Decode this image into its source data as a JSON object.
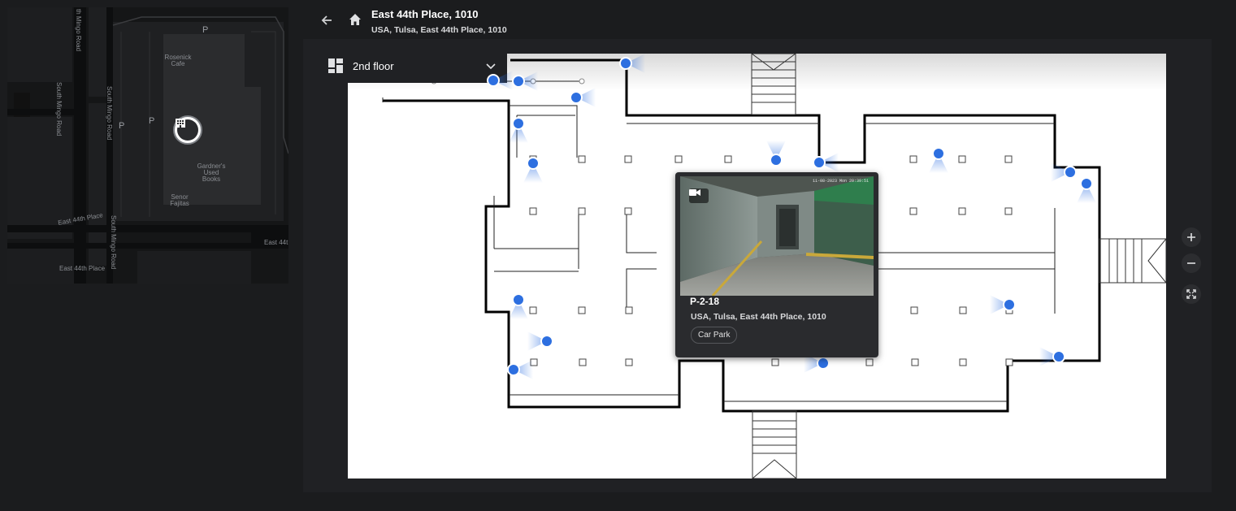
{
  "header": {
    "title": "East 44th Place, 1010",
    "subtitle": "USA, Tulsa, East 44th Place, 1010"
  },
  "minimap": {
    "labels": {
      "road_1": "th Mingo Road",
      "road_2": "South Mingo Road",
      "road_3": "South Mingo Road",
      "road_4": "East 44th Place",
      "road_5": "South Mingo Road",
      "road_6": "East 44th Place",
      "road_7": "East 44t",
      "poi_1": "Rosenick Cafe",
      "poi_2": "Gardner's Used Books",
      "poi_3": "Senor Fajitas",
      "parking": "P"
    }
  },
  "floor_selector": {
    "label": "2nd floor"
  },
  "popup": {
    "name": "P-2-18",
    "address": "USA, Tulsa, East 44th Place, 1010",
    "tag": "Car Park",
    "timestamp": "11-08-2023 Mon 20:39:51"
  },
  "icons": {
    "back": "arrow-left-icon",
    "home": "home-icon",
    "floor": "floor-plan-icon",
    "chevron": "chevron-down-icon",
    "camera": "camera-marker-icon",
    "zoom_in": "plus-icon",
    "zoom_out": "minus-icon",
    "fullscreen": "fullscreen-icon"
  },
  "colors": {
    "camera": "#2d6fe0",
    "background": "#1b1c1e"
  }
}
